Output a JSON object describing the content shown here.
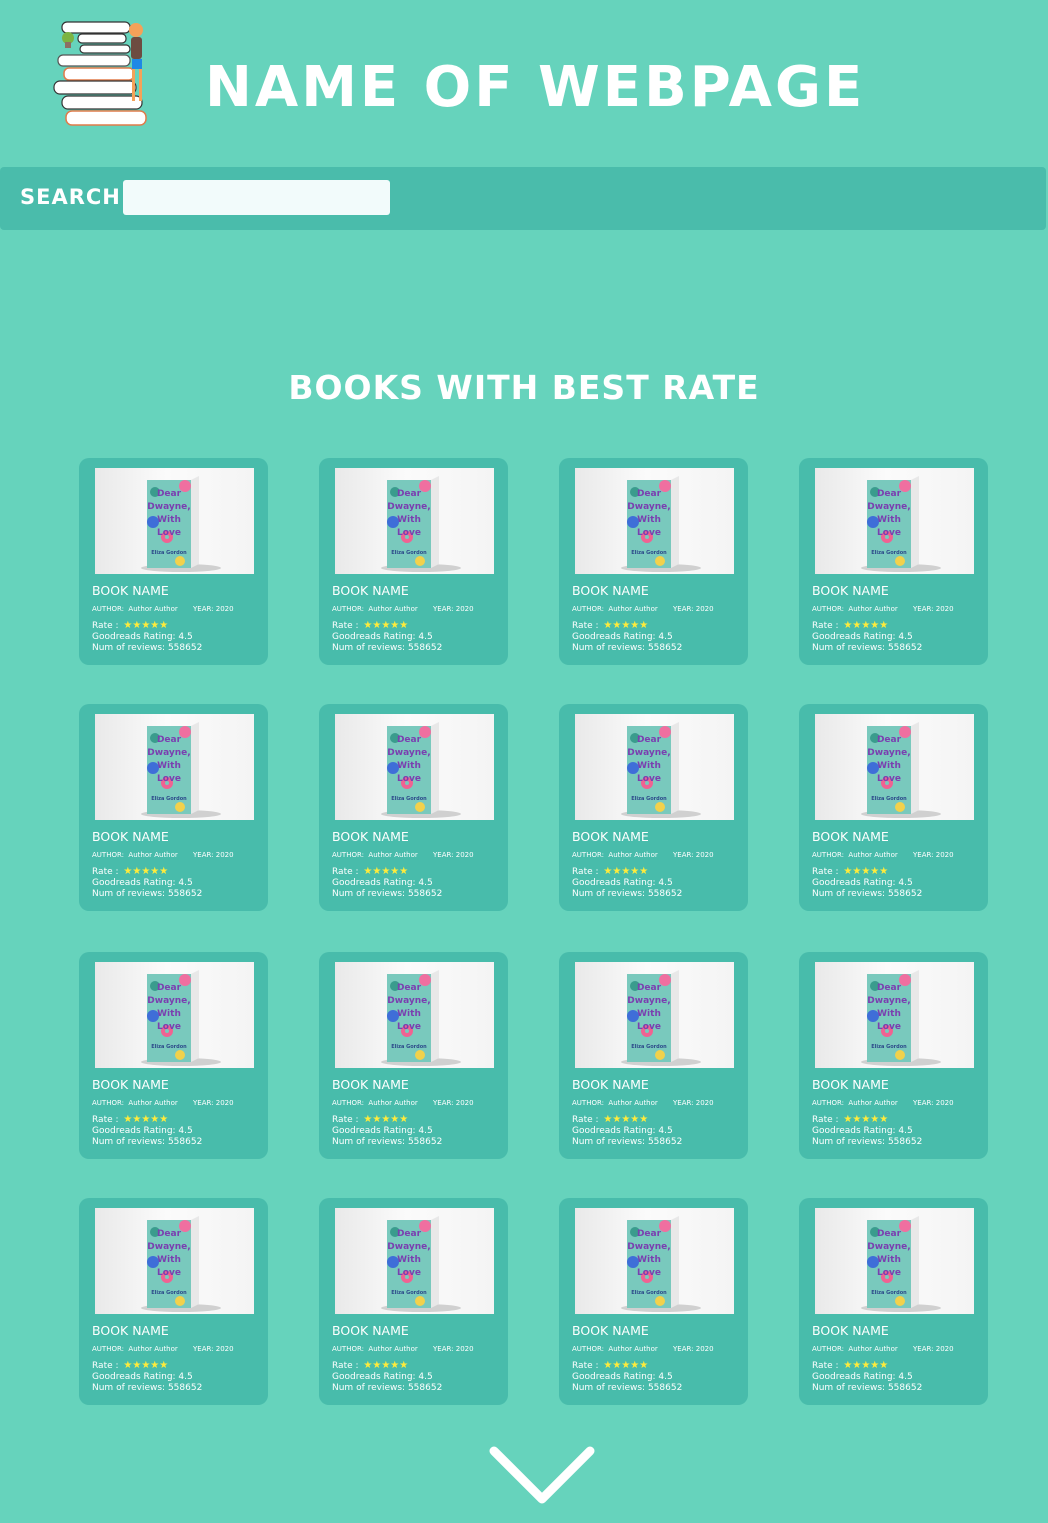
{
  "header": {
    "title": "NAME OF WEBPAGE"
  },
  "search": {
    "label": "SEARCH",
    "value": "",
    "placeholder": ""
  },
  "section": {
    "title": "BOOKS WITH BEST RATE"
  },
  "book_template": {
    "name": "BOOK NAME",
    "author_label": "AUTHOR:",
    "author": "Author Author",
    "year_label": "YEAR:",
    "year": "2020",
    "rate_label": "Rate :",
    "stars": "★★★★★",
    "rating_stars_value": 5,
    "goodreads": "Goodreads Rating: 4.5",
    "reviews": "Num of reviews: 558652",
    "cover_text": [
      "Dear",
      "Dwayne,",
      "With",
      "Love",
      "Eliza Gordon"
    ]
  },
  "books_count": 16,
  "colors": {
    "background": "#66d3bc",
    "panel": "#48bcab",
    "stars": "#ffeb3b",
    "text": "#ffffff"
  },
  "icons": {
    "logo": "book-stack-logo-icon",
    "more": "chevron-down-icon"
  }
}
